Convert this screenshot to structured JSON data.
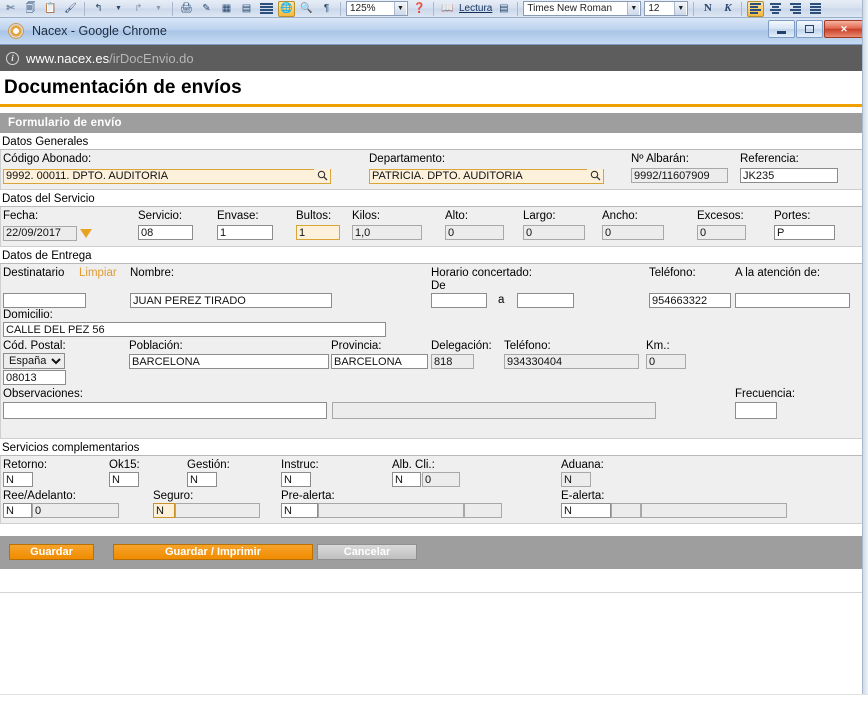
{
  "word_toolbar": {
    "zoom_value": "125%",
    "reading_label": "Lectura",
    "font_name": "Times New Roman",
    "font_size": "12",
    "bold_glyph": "N",
    "italic_glyph": "K"
  },
  "window": {
    "title": "Nacex - Google Chrome",
    "minimize_label": "Minimizar",
    "maximize_label": "Maximizar",
    "close_label": "✕"
  },
  "url": {
    "host": "www.nacex.es",
    "path": "/irDocEnvio.do"
  },
  "page": {
    "title": "Documentación de envíos",
    "section_title": "Formulario de envío",
    "accent_color": "#f0a000",
    "bar_color": "#9e9e9e"
  },
  "groups": {
    "datos_generales": "Datos Generales",
    "datos_servicio": "Datos del Servicio",
    "datos_entrega": "Datos de Entrega",
    "servicios_complementarios": "Servicios complementarios"
  },
  "datos_generales": {
    "codigo_abonado_label": "Código Abonado:",
    "codigo_abonado_value": "9992. 00011. DPTO. AUDITORIA",
    "departamento_label": "Departamento:",
    "departamento_value": "PATRICIA. DPTO. AUDITORIA",
    "albaran_label": "Nº Albarán:",
    "albaran_value": "9992/11607909",
    "referencia_label": "Referencia:",
    "referencia_value": "JK235"
  },
  "datos_servicio": {
    "fecha_label": "Fecha:",
    "fecha_value": "22/09/2017",
    "servicio_label": "Servicio:",
    "servicio_value": "08",
    "envase_label": "Envase:",
    "envase_value": "1",
    "bultos_label": "Bultos:",
    "bultos_value": "1",
    "kilos_label": "Kilos:",
    "kilos_value": "1,0",
    "alto_label": "Alto:",
    "alto_value": "0",
    "largo_label": "Largo:",
    "largo_value": "0",
    "ancho_label": "Ancho:",
    "ancho_value": "0",
    "excesos_label": "Excesos:",
    "excesos_value": "0",
    "portes_label": "Portes:",
    "portes_value": "P"
  },
  "datos_entrega": {
    "destinatario_label": "Destinatario",
    "limpiar_label": "Limpiar",
    "destinatario_value": "",
    "nombre_label": "Nombre:",
    "nombre_value": "JUAN PEREZ TIRADO",
    "horario_label": "Horario concertado:",
    "de_label": "De",
    "de_value": "",
    "a_label": "a",
    "a_value": "",
    "telefono_label": "Teléfono:",
    "telefono_value": "954663322",
    "atencion_label": "A la atención de:",
    "atencion_value": "",
    "domicilio_label": "Domicilio:",
    "domicilio_value": "CALLE DEL PEZ 56",
    "cod_postal_label": "Cód. Postal:",
    "pais_value": "España",
    "cp_value": "08013",
    "poblacion_label": "Población:",
    "poblacion_value": "BARCELONA",
    "provincia_label": "Provincia:",
    "provincia_value": "BARCELONA",
    "delegacion_label": "Delegación:",
    "delegacion_value": "818",
    "telefono2_label": "Teléfono:",
    "telefono2_value": "934330404",
    "km_label": "Km.:",
    "km_value": "0",
    "observaciones_label": "Observaciones:",
    "observaciones_value": "",
    "observaciones2_value": "",
    "frecuencia_label": "Frecuencia:",
    "frecuencia_value": ""
  },
  "servicios_complementarios": {
    "retorno_label": "Retorno:",
    "retorno_value": "N",
    "ok15_label": "Ok15:",
    "ok15_value": "N",
    "gestion_label": "Gestión:",
    "gestion_value": "N",
    "instruc_label": "Instruc:",
    "instruc_value": "N",
    "alb_cli_label": "Alb. Cli.:",
    "alb_cli_value": "N",
    "alb_cli_value2": "0",
    "aduana_label": "Aduana:",
    "aduana_value": "N",
    "ree_label": "Ree/Adelanto:",
    "ree_value": "N",
    "ree_value2": "0",
    "ree_value3": "",
    "seguro_label": "Seguro:",
    "seguro_value": "N",
    "seguro_value2": "",
    "prealerta_label": "Pre-alerta:",
    "prealerta_value": "N",
    "prealerta_value2": "",
    "prealerta_value3": "",
    "ealerta_label": "E-alerta:",
    "ealerta_value": "N",
    "ealerta_value2": "",
    "ealerta_value3": ""
  },
  "buttons": {
    "guardar": "Guardar",
    "guardar_imprimir": "Guardar / Imprimir",
    "cancelar": "Cancelar"
  }
}
